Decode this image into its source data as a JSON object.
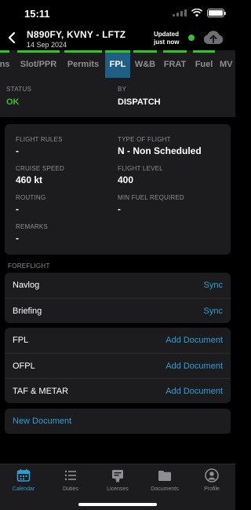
{
  "status_bar": {
    "time": "15:11"
  },
  "header": {
    "title": "N890FY, KVNY - LFTZ",
    "date": "14 Sep 2024",
    "updated_line1": "Updated",
    "updated_line2": "just now"
  },
  "tabs": [
    {
      "label": "ns",
      "state": "ok"
    },
    {
      "label": "Slot/PPR",
      "state": "ok"
    },
    {
      "label": "Permits",
      "state": "ok"
    },
    {
      "label": "FPL",
      "state": "active"
    },
    {
      "label": "W&B",
      "state": "ok"
    },
    {
      "label": "FRAT",
      "state": "ok"
    },
    {
      "label": "Fuel",
      "state": "ok"
    },
    {
      "label": "MV",
      "state": "none"
    }
  ],
  "status": {
    "status_label": "STATUS",
    "status_value": "OK",
    "by_label": "BY",
    "by_value": "DISPATCH"
  },
  "flight": {
    "rules_label": "FLIGHT RULES",
    "rules_value": "-",
    "type_label": "TYPE OF FLIGHT",
    "type_value": "N - Non Scheduled",
    "speed_label": "CRUISE SPEED",
    "speed_value": "460 kt",
    "level_label": "FLIGHT LEVEL",
    "level_value": "400",
    "routing_label": "ROUTING",
    "routing_value": "-",
    "fuel_label": "MIN FUEL REQUIRED",
    "fuel_value": "-",
    "remarks_label": "REMARKS",
    "remarks_value": "-"
  },
  "foreflight": {
    "section_label": "FOREFLIGHT",
    "navlog_label": "Navlog",
    "navlog_action": "Sync",
    "briefing_label": "Briefing",
    "briefing_action": "Sync"
  },
  "documents": [
    {
      "label": "FPL",
      "action": "Add Document"
    },
    {
      "label": "OFPL",
      "action": "Add Document"
    },
    {
      "label": "TAF & METAR",
      "action": "Add Document"
    }
  ],
  "new_document": "New Document",
  "tabbar": [
    {
      "label": "Calendar",
      "icon": "calendar-icon",
      "active": true
    },
    {
      "label": "Duties",
      "icon": "list-icon",
      "active": false
    },
    {
      "label": "Licenses",
      "icon": "license-icon",
      "active": false
    },
    {
      "label": "Documents",
      "icon": "folder-icon",
      "active": false
    },
    {
      "label": "Profile",
      "icon": "profile-icon",
      "active": false
    }
  ],
  "colors": {
    "accent": "#2a9fd6",
    "ok_green": "#37c12a",
    "active_tab": "#1f5f85",
    "card_bg": "#1c1c1e",
    "background": "#000000"
  }
}
